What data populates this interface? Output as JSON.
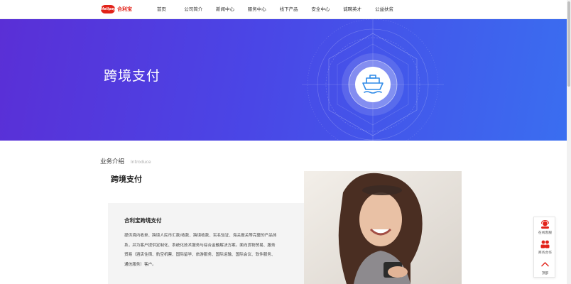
{
  "header": {
    "logo": {
      "badge": "Helipay",
      "name": "合利宝"
    },
    "nav": [
      "首页",
      "公司简介",
      "新闻中心",
      "服务中心",
      "线下产品",
      "安全中心",
      "诚聘英才",
      "公益扶贫"
    ]
  },
  "banner": {
    "title": "跨境支付",
    "icon": "cargo-ship-icon"
  },
  "intro": {
    "section_title": "业务介绍",
    "section_sub": "Introduce",
    "title": "跨境支付",
    "card_title": "合利宝跨境支付",
    "card_lines": [
      "提供境内收单、跨境人民币汇款/收款、跨境收款、实名验证、海关报关等完整的产品体",
      "系，并为客户提供定制化、系统化技术服务与综合金融解决方案。面向货物贸易、服务",
      "贸易（酒店住宿、航空机票、国际留学、旅游服务、国际运输、国际会议、软件服务、",
      "通信服务）客户。"
    ]
  },
  "side_tools": [
    {
      "label": "在线客服",
      "icon": "customer-service-icon"
    },
    {
      "label": "商务合作",
      "icon": "business-cooperation-icon"
    },
    {
      "label": "顶部",
      "icon": "back-to-top-icon"
    }
  ],
  "colors": {
    "brand_red": "#e2231a",
    "banner_start": "#5a2fd6",
    "banner_end": "#3a6ef0"
  }
}
